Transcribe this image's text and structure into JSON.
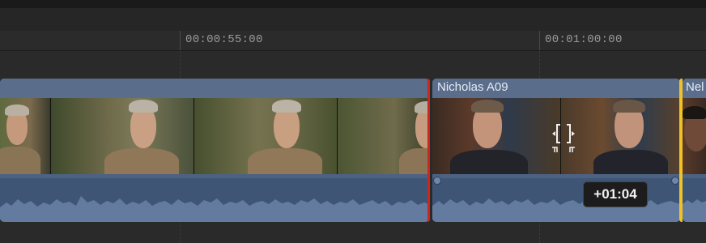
{
  "timeline": {
    "ruler": {
      "timecodes": [
        "00:00:55:00",
        "00:01:00:00"
      ]
    },
    "clips": [
      {
        "name": ""
      },
      {
        "name": "Nicholas A09"
      },
      {
        "name": "Nel"
      }
    ],
    "trim_delta": "+01:04",
    "colors": {
      "clip_header": "#5a6d8a",
      "audio_waveform": "#3e5575",
      "selection_left_edge": "#c9271f",
      "selection_right_edge": "#f0c228"
    }
  }
}
